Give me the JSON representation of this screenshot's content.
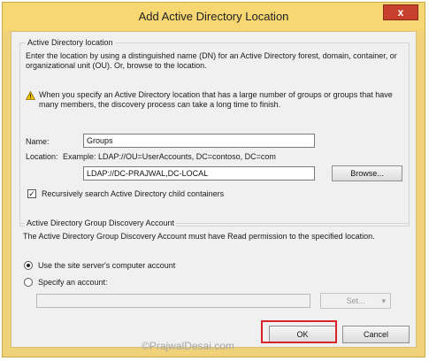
{
  "window": {
    "title": "Add Active Directory Location",
    "close_glyph": "x"
  },
  "location_group": {
    "legend": "Active Directory location",
    "description": "Enter the location by using a distinguished name (DN) for an Active Directory forest, domain, container, or organizational unit (OU). Or, browse to the location.",
    "warning": "When you specify an Active Directory location that has a large number of groups or groups that have many members, the discovery process can take a long time to finish.",
    "name_label": "Name:",
    "name_value": "Groups",
    "location_label": "Location:",
    "location_example": "Example: LDAP://OU=UserAccounts, DC=contoso, DC=com",
    "location_value": "LDAP://DC-PRAJWAL,DC-LOCAL",
    "browse_label": "Browse...",
    "recursive_label": "Recursively search Active Directory child containers",
    "recursive_checked": true
  },
  "account_group": {
    "legend": "Active Directory Group Discovery Account",
    "description": "The Active Directory Group Discovery Account must have Read permission to the specified location.",
    "option_computer": "Use the site server's computer account",
    "option_specify": "Specify an account:",
    "selected": "computer",
    "account_value": "",
    "set_label": "Set..."
  },
  "footer": {
    "ok_label": "OK",
    "cancel_label": "Cancel"
  },
  "watermark": "©PrajwalDesai.com",
  "colors": {
    "highlight": "#d9232a",
    "titlebar": "#f6d772",
    "close": "#c7402b"
  },
  "icons": [
    "warning-icon",
    "close-icon",
    "dropdown-arrow-icon",
    "check-icon"
  ]
}
